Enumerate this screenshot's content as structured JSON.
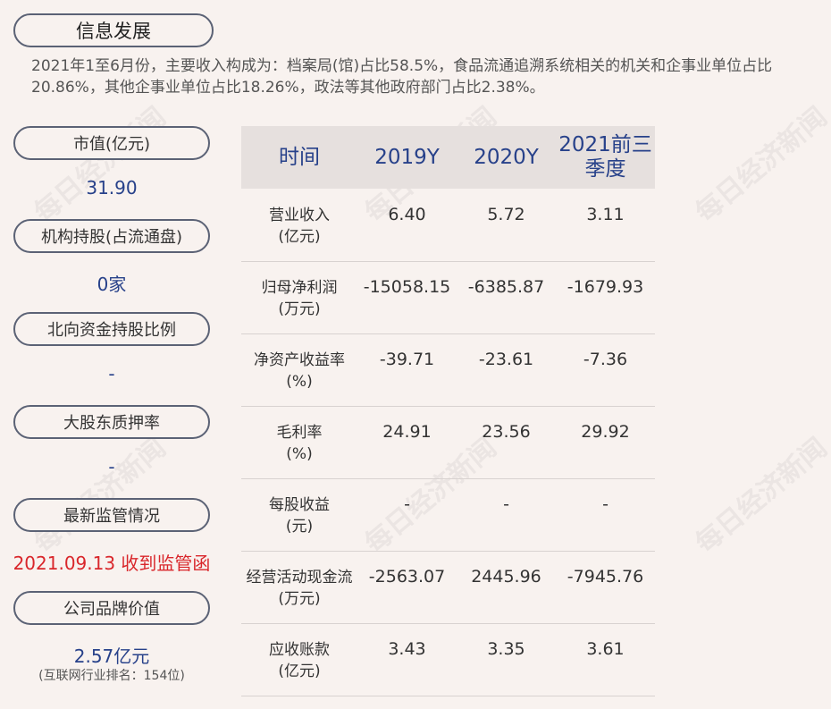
{
  "title": "信息发展",
  "summary": "2021年1至6月份，主要收入构成为：档案局(馆)占比58.5%，食品流通追溯系统相关的机关和企事业单位占比20.86%，其他企事业单位占比18.26%，政法等其他政府部门占比2.38%。",
  "left": {
    "market_cap_label": "市值(亿元)",
    "market_cap_value": "31.90",
    "institution_label": "机构持股(占流通盘)",
    "institution_value": "0家",
    "northbound_label": "北向资金持股比例",
    "northbound_value": "-",
    "pledge_label": "大股东质押率",
    "pledge_value": "-",
    "regulation_label": "最新监管情况",
    "regulation_value": "2021.09.13 收到监管函",
    "brand_label": "公司品牌价值",
    "brand_value": "2.57亿元",
    "brand_rank": "(互联网行业排名：154位)"
  },
  "table": {
    "headers": [
      "时间",
      "2019Y",
      "2020Y",
      "2021前三季度"
    ],
    "rows": [
      {
        "label": "营业收入",
        "unit": "(亿元)",
        "values": [
          "6.40",
          "5.72",
          "3.11"
        ]
      },
      {
        "label": "归母净利润",
        "unit": "(万元)",
        "values": [
          "-15058.15",
          "-6385.87",
          "-1679.93"
        ]
      },
      {
        "label": "净资产收益率",
        "unit": "(%)",
        "values": [
          "-39.71",
          "-23.61",
          "-7.36"
        ]
      },
      {
        "label": "毛利率",
        "unit": "(%)",
        "values": [
          "24.91",
          "23.56",
          "29.92"
        ]
      },
      {
        "label": "每股收益",
        "unit": "(元)",
        "values": [
          "-",
          "-",
          "-"
        ]
      },
      {
        "label": "经营活动现金流",
        "unit": "(万元)",
        "values": [
          "-2563.07",
          "2445.96",
          "-7945.76"
        ]
      },
      {
        "label": "应收账款",
        "unit": "(亿元)",
        "values": [
          "3.43",
          "3.35",
          "3.61"
        ]
      }
    ]
  },
  "watermark": "每日经济新闻",
  "colors": {
    "background": "#f8f2ef",
    "value_blue": "#27418a",
    "alert_red": "#d9262b",
    "header_bg": "#e6e0de"
  }
}
